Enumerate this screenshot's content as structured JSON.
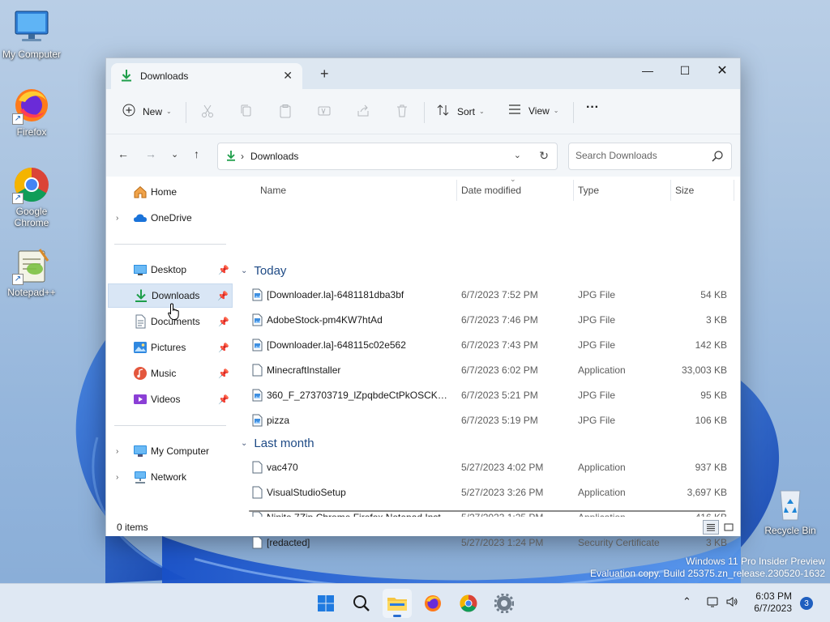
{
  "desktop": {
    "icons": [
      {
        "label": "My Computer",
        "icon": "computer-icon"
      },
      {
        "label": "Firefox",
        "icon": "firefox-icon"
      },
      {
        "label": "Google\nChrome",
        "icon": "chrome-icon"
      },
      {
        "label": "Notepad++",
        "icon": "notepadpp-icon"
      },
      {
        "label": "Recycle Bin",
        "icon": "recycle-bin-icon"
      }
    ],
    "watermark_line1": "Windows 11 Pro Insider Preview",
    "watermark_line2": "Evaluation copy. Build 25375.zn_release.230520-1632"
  },
  "window": {
    "tab_title": "Downloads",
    "toolbar": {
      "new_label": "New",
      "sort_label": "Sort",
      "view_label": "View",
      "more_label": "···"
    },
    "address": {
      "crumb": "Downloads",
      "search_placeholder": "Search Downloads"
    },
    "sidebar": {
      "items": [
        {
          "label": "Home",
          "icon": "home-icon"
        },
        {
          "label": "OneDrive",
          "icon": "cloud-icon"
        },
        {
          "label": "Desktop",
          "icon": "desktop-icon"
        },
        {
          "label": "Downloads",
          "icon": "download-icon"
        },
        {
          "label": "Documents",
          "icon": "document-icon"
        },
        {
          "label": "Pictures",
          "icon": "pictures-icon"
        },
        {
          "label": "Music",
          "icon": "music-icon"
        },
        {
          "label": "Videos",
          "icon": "videos-icon"
        },
        {
          "label": "My Computer",
          "icon": "computer-icon"
        },
        {
          "label": "Network",
          "icon": "network-icon"
        }
      ]
    },
    "columns": {
      "name": "Name",
      "date": "Date modified",
      "type": "Type",
      "size": "Size"
    },
    "groups": [
      {
        "label": "Today",
        "files": [
          {
            "name": "[Downloader.la]-6481181dba3bf",
            "date": "6/7/2023 7:52 PM",
            "type": "JPG File",
            "size": "54 KB",
            "icon": "image-file-icon"
          },
          {
            "name": "AdobeStock-pm4KW7htAd",
            "date": "6/7/2023 7:46 PM",
            "type": "JPG File",
            "size": "3 KB",
            "icon": "image-file-icon"
          },
          {
            "name": "[Downloader.la]-648115c02e562",
            "date": "6/7/2023 7:43 PM",
            "type": "JPG File",
            "size": "142 KB",
            "icon": "image-file-icon"
          },
          {
            "name": "MinecraftInstaller",
            "date": "6/7/2023 6:02 PM",
            "type": "Application",
            "size": "33,003 KB",
            "icon": "app-file-icon"
          },
          {
            "name": "360_F_273703719_lZpqbdeCtPkOSCKSznj...",
            "date": "6/7/2023 5:21 PM",
            "type": "JPG File",
            "size": "95 KB",
            "icon": "image-file-icon"
          },
          {
            "name": "pizza",
            "date": "6/7/2023 5:19 PM",
            "type": "JPG File",
            "size": "106 KB",
            "icon": "image-file-icon"
          }
        ]
      },
      {
        "label": "Last month",
        "files": [
          {
            "name": "vac470",
            "date": "5/27/2023 4:02 PM",
            "type": "Application",
            "size": "937 KB",
            "icon": "app-file-icon"
          },
          {
            "name": "VisualStudioSetup",
            "date": "5/27/2023 3:26 PM",
            "type": "Application",
            "size": "3,697 KB",
            "icon": "app-file-icon"
          },
          {
            "name": "Ninite 7Zip Chrome Firefox Notepad Inst...",
            "date": "5/27/2023 1:25 PM",
            "type": "Application",
            "size": "416 KB",
            "icon": "app-file-icon"
          },
          {
            "name": "[redacted]",
            "date": "5/27/2023 1:24 PM",
            "type": "Security Certificate",
            "size": "3 KB",
            "icon": "certificate-file-icon"
          }
        ]
      }
    ],
    "status": {
      "count": "0 items"
    }
  },
  "taskbar": {
    "apps": [
      "start-icon",
      "search-icon",
      "file-explorer-icon",
      "firefox-icon",
      "chrome-icon",
      "settings-icon"
    ],
    "time": "6:03 PM",
    "date": "6/7/2023",
    "notification_count": "3"
  },
  "colors": {
    "accent": "#2a6dd0",
    "selection": "#d9e6f5",
    "download_green": "#1e9e4a",
    "group_header": "#1e4a85"
  }
}
